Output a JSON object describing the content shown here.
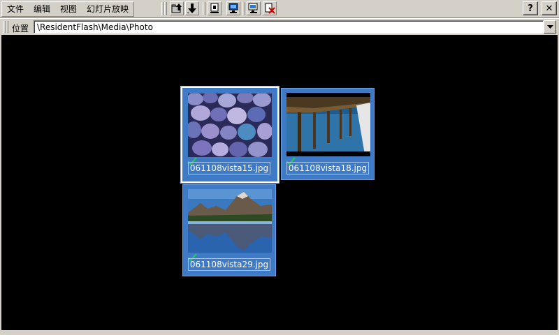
{
  "menu": {
    "items": [
      {
        "label": "文件"
      },
      {
        "label": "编辑"
      },
      {
        "label": "视图"
      },
      {
        "label": "幻灯片放映"
      }
    ]
  },
  "toolbar": {
    "buttons": [
      "up-folder-icon",
      "download-icon",
      "properties-icon",
      "display-icon",
      "slideshow-icon",
      "delete-icon"
    ],
    "help_label": "?",
    "close_label": "✕"
  },
  "address": {
    "label": "位置",
    "value": "\\ResidentFlash\\Media\\Photo"
  },
  "files": [
    {
      "name": "061108vista15.jpg",
      "selected": true,
      "checked": true
    },
    {
      "name": "061108vista18.jpg",
      "selected": false,
      "checked": true
    },
    {
      "name": "061108vista29.jpg",
      "selected": false,
      "checked": true
    }
  ],
  "colors": {
    "content_bg": "#000000",
    "tile_bg": "#3f7ac6",
    "check": "#22c55e"
  }
}
